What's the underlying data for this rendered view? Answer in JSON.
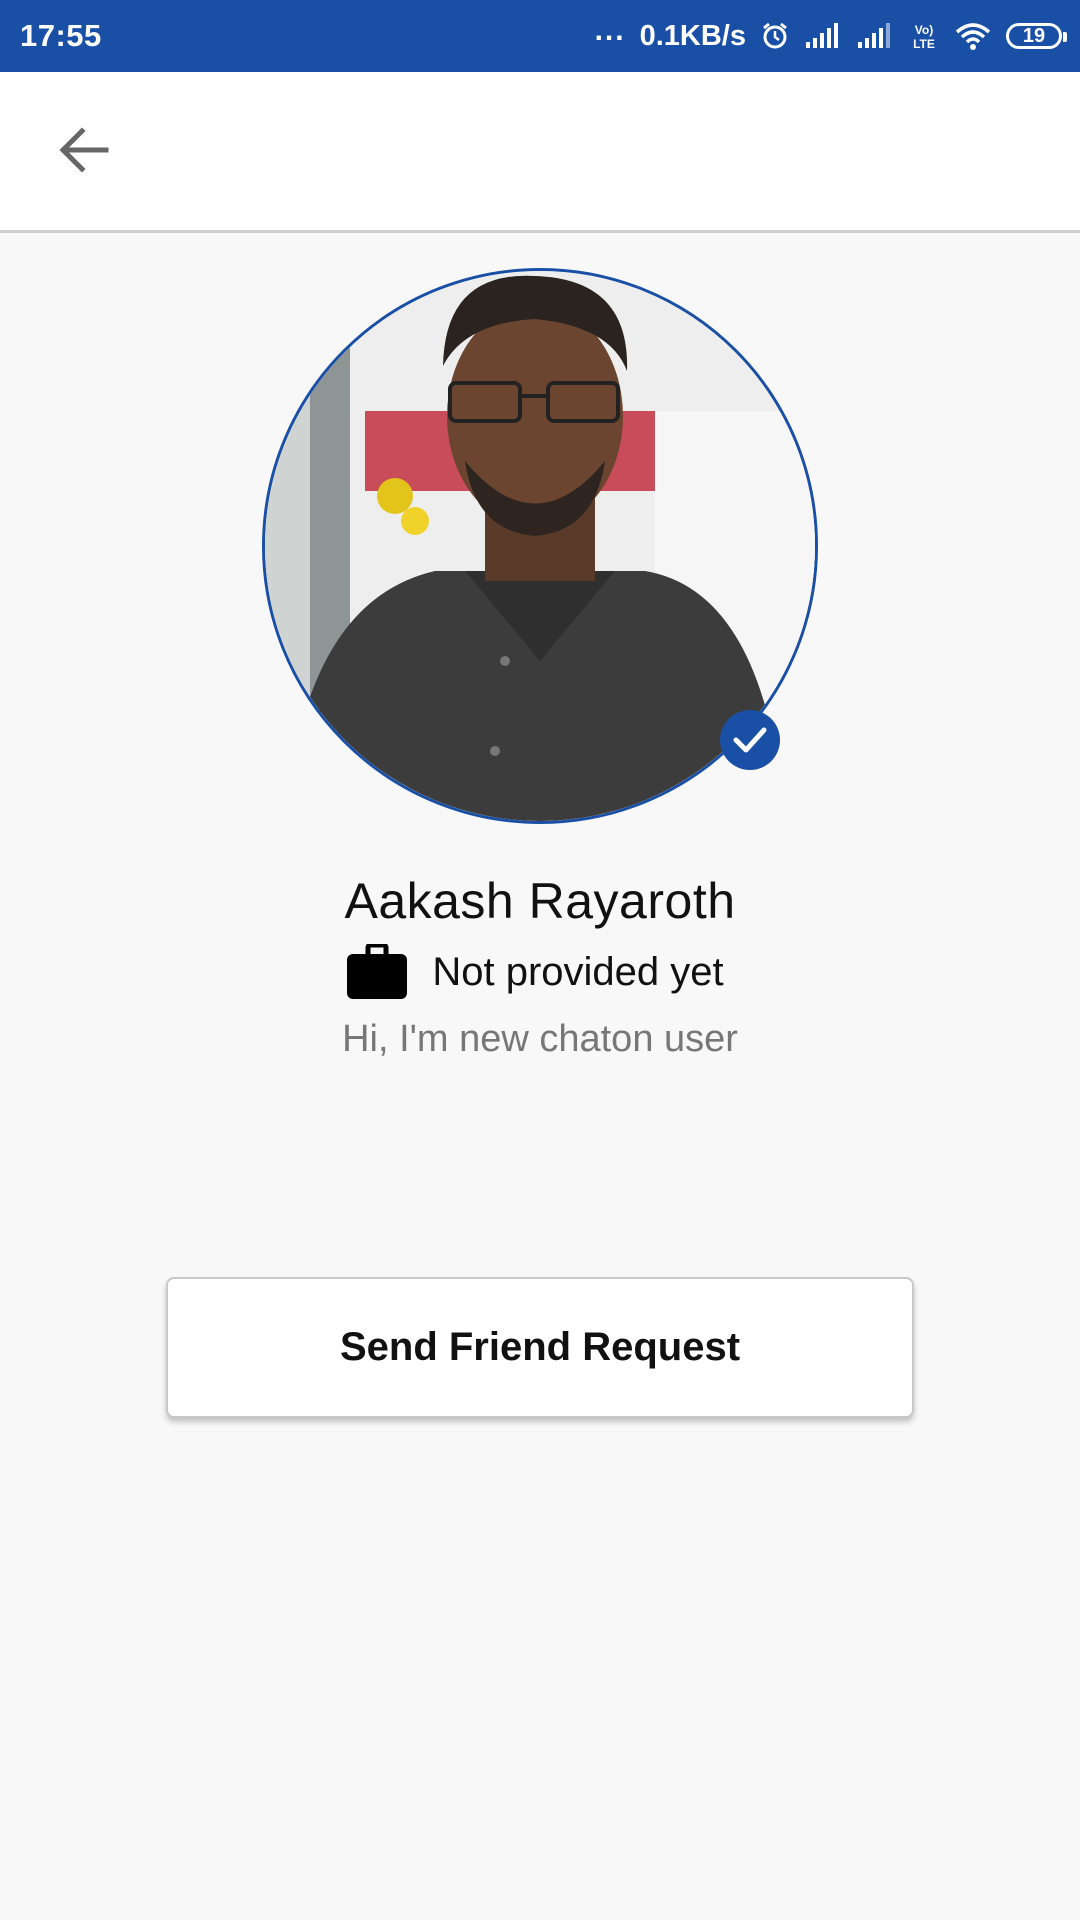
{
  "status_bar": {
    "time": "17:55",
    "dots": "...",
    "network_speed": "0.1KB/s",
    "battery_level": "19",
    "icons": [
      "alarm-icon",
      "signal-icon",
      "signal-icon",
      "volte-icon",
      "wifi-icon",
      "battery-icon"
    ],
    "volte_label": "Vo LTE"
  },
  "app_bar": {
    "back_icon": "arrow-left-icon"
  },
  "profile": {
    "name": "Aakash Rayaroth",
    "job_icon": "briefcase-icon",
    "job": "Not provided yet",
    "status_message": "Hi, I'm new chaton user",
    "verified": true
  },
  "actions": {
    "send_friend_request_label": "Send Friend Request"
  },
  "colors": {
    "primary": "#1a4fa6",
    "background": "#f8f8f8",
    "secondary_text": "#777777"
  }
}
